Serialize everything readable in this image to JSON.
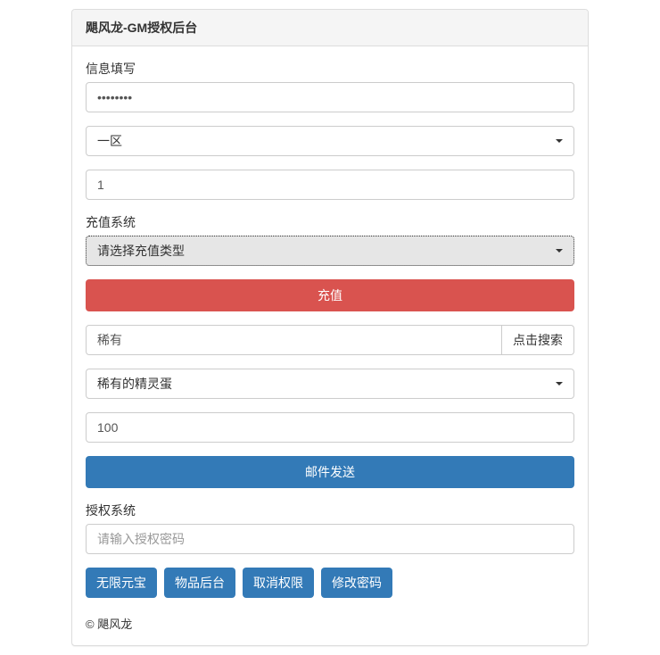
{
  "header": {
    "title": "飓风龙-GM授权后台"
  },
  "info_section": {
    "label": "信息填写",
    "password_value": "password",
    "zone_selected": "一区",
    "role_id_value": "1"
  },
  "recharge_section": {
    "label": "充值系统",
    "type_placeholder": "请选择充值类型",
    "submit_label": "充值"
  },
  "item_section": {
    "search_value": "稀有",
    "search_button": "点击搜索",
    "item_selected": "稀有的精灵蛋",
    "quantity_value": "100",
    "send_label": "邮件发送"
  },
  "auth_section": {
    "label": "授权系统",
    "password_placeholder": "请输入授权密码",
    "buttons": {
      "unlimited_gold": "无限元宝",
      "item_backend": "物品后台",
      "revoke_auth": "取消权限",
      "change_password": "修改密码"
    }
  },
  "footer": {
    "copyright": "© 飓风龙"
  }
}
